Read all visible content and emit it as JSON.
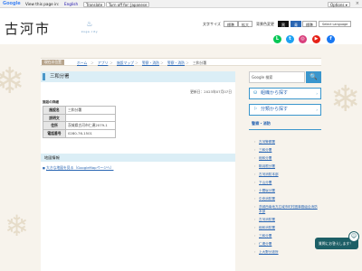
{
  "google_bar": {
    "logo": "Google",
    "view_text": "View this page in:",
    "language": "English",
    "translate_label": "Translate",
    "original_label": "Turn off for: Japanese",
    "options_label": "Options ▾",
    "close": "×"
  },
  "header": {
    "logo_text": "古河市",
    "logo_sub": "koga city",
    "font_size_label": "文字サイズ",
    "font_standard": "標準",
    "font_large": "拡大",
    "bg_color_label": "背景色変更",
    "bg_black": "黒",
    "bg_blue": "青",
    "bg_standard": "標準",
    "select_language": "Select Language"
  },
  "sns": [
    {
      "name": "line-icon",
      "glyph": "L",
      "color": "#06c755"
    },
    {
      "name": "twitter-icon",
      "glyph": "t",
      "color": "#1da1f2"
    },
    {
      "name": "instagram-icon",
      "glyph": "◎",
      "color": "#d93f7c"
    },
    {
      "name": "youtube-icon",
      "glyph": "▶",
      "color": "#e62117"
    },
    {
      "name": "facebook-icon",
      "glyph": "f",
      "color": "#1877f2"
    }
  ],
  "breadcrumb": {
    "current_location": "現在の位置",
    "items": [
      "ホーム",
      "アプリ",
      "施設マップ",
      "警察・消防",
      "警察・消防",
      "三和分署"
    ]
  },
  "main": {
    "title": "三和分署",
    "updated": "更新日：2023年07月07日",
    "section_label": "施設の詳細",
    "table": [
      {
        "head": "施設名",
        "value": "三和分署"
      },
      {
        "head": "説明文",
        "value": ""
      },
      {
        "head": "住所",
        "value": "茨城県古河市仁連2079-1"
      },
      {
        "head": "電話番号",
        "value": "0280-76-1501"
      }
    ],
    "map_heading": "地図情報",
    "map_link": "大きな地図を見る（GoogleMapページへ）"
  },
  "sidebar": {
    "search_placeholder": "Google 検索",
    "search_button": "🔍",
    "btn_organization": "組織から探す",
    "btn_category": "分類から探す",
    "heading": "警察・消防",
    "items": [
      "古河警察署",
      "三和分署",
      "総和分署",
      "駒羽根分署",
      "古河消防本部",
      "下山分署",
      "十間坂分署",
      "中央消防署",
      "茨城西南地方広域市町村圏事務組合消防本部",
      "古河消防署",
      "総和消防署",
      "三和分署",
      "仁連分署",
      "上大野分遣所"
    ]
  },
  "chat": {
    "label": "質問にお答えします！"
  },
  "colors": {
    "accent": "#3a96cd",
    "title_bg": "#dbeef6",
    "page_bg": "#f7f3ec"
  }
}
